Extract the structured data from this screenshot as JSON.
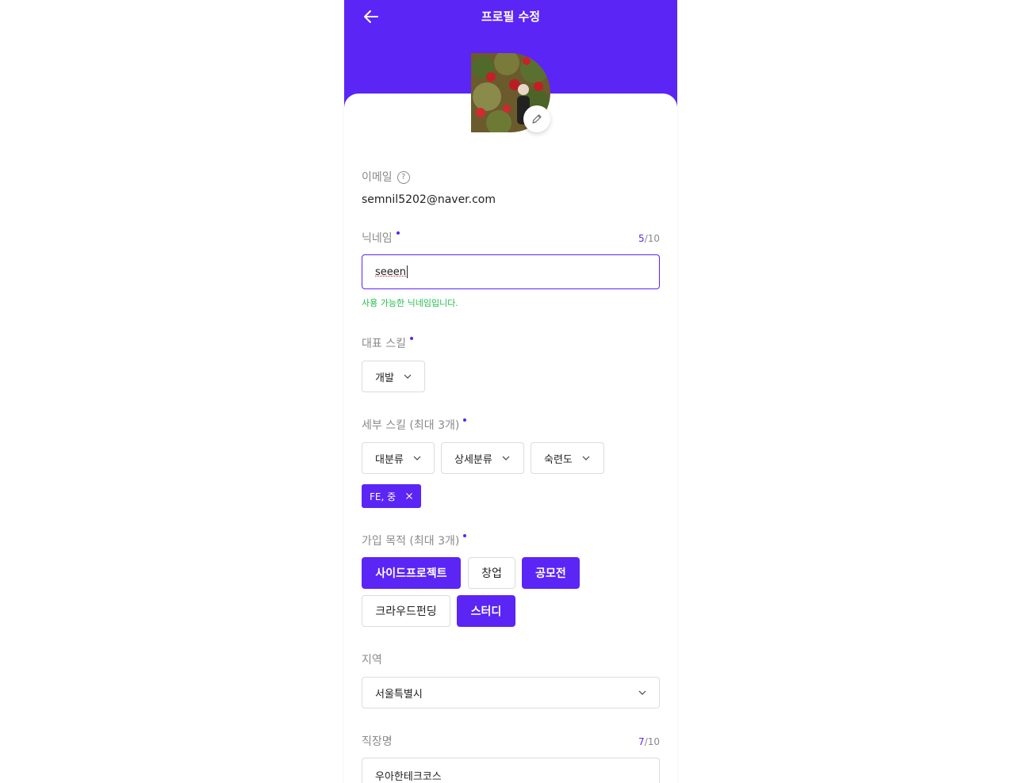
{
  "header": {
    "title": "프로필 수정"
  },
  "email": {
    "label": "이메일",
    "help": "?",
    "value": "semnil5202@naver.com"
  },
  "nickname": {
    "label": "닉네임",
    "count_current": "5",
    "count_max": "/10",
    "value": "seeen",
    "success_message": "사용 가능한 닉네임입니다."
  },
  "main_skill": {
    "label": "대표 스킬",
    "selected": "개발"
  },
  "detail_skill": {
    "label": "세부 스킬 (최대 3개)",
    "category_placeholder": "대분류",
    "subcategory_placeholder": "상세분류",
    "level_placeholder": "숙련도",
    "tags": [
      "FE, 중"
    ]
  },
  "purpose": {
    "label": "가입 목적 (최대 3개)",
    "options": [
      {
        "label": "사이드프로젝트",
        "selected": true
      },
      {
        "label": "창업",
        "selected": false
      },
      {
        "label": "공모전",
        "selected": true
      },
      {
        "label": "크라우드펀딩",
        "selected": false
      },
      {
        "label": "스터디",
        "selected": true
      }
    ]
  },
  "region": {
    "label": "지역",
    "selected": "서울특별시"
  },
  "company": {
    "label": "직장명",
    "count_current": "7",
    "count_max": "/10",
    "value": "우아한테크코스"
  },
  "colors": {
    "accent": "#5b25f5",
    "success": "#1fbf4a",
    "border": "#dcdcdc",
    "label": "#8a8a8a"
  },
  "icons": {
    "back": "arrow-left-icon",
    "edit": "pencil-icon",
    "help": "question-circle-icon",
    "dropdown": "chevron-down-icon",
    "remove": "close-icon"
  }
}
